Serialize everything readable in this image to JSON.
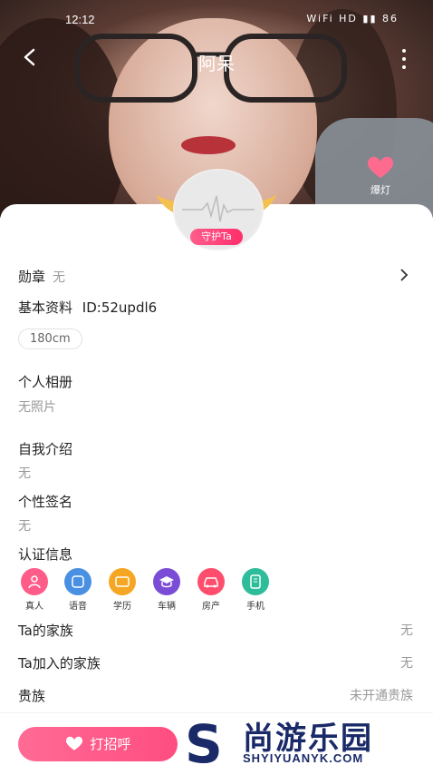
{
  "status": {
    "time": "12:12",
    "icons_text": "WiFi HD ▮▮ 86"
  },
  "header": {
    "title": "阿呆"
  },
  "hero": {
    "photo_text": "",
    "spotlight_label": "爆灯"
  },
  "avatar": {
    "guard_label": "守护Ta"
  },
  "medal": {
    "label": "勋章",
    "value": "无"
  },
  "basic": {
    "label": "基本资料",
    "id_text": "ID:52updl6",
    "height_chip": "180cm"
  },
  "album": {
    "label": "个人相册",
    "empty_text": "无照片"
  },
  "intro": {
    "label": "自我介绍",
    "value": "无"
  },
  "signature": {
    "label": "个性签名",
    "value": "无"
  },
  "cert": {
    "label": "认证信息",
    "items": [
      {
        "label": "真人",
        "color": "#ff5c8a"
      },
      {
        "label": "语音",
        "color": "#4a90e2"
      },
      {
        "label": "学历",
        "color": "#f5a623"
      },
      {
        "label": "车辆",
        "color": "#7b4dd6"
      },
      {
        "label": "房产",
        "color": "#ff4d6d"
      },
      {
        "label": "手机",
        "color": "#2ebd9a"
      }
    ]
  },
  "family": {
    "label": "Ta的家族",
    "value": "无"
  },
  "joined_family": {
    "label": "Ta加入的家族",
    "value": "无"
  },
  "noble": {
    "label": "贵族",
    "value": "未开通贵族"
  },
  "bottom": {
    "greet_label": "打招呼"
  },
  "watermark": {
    "cn": "尚游乐园",
    "en": "SHYIYUANYK.COM"
  }
}
